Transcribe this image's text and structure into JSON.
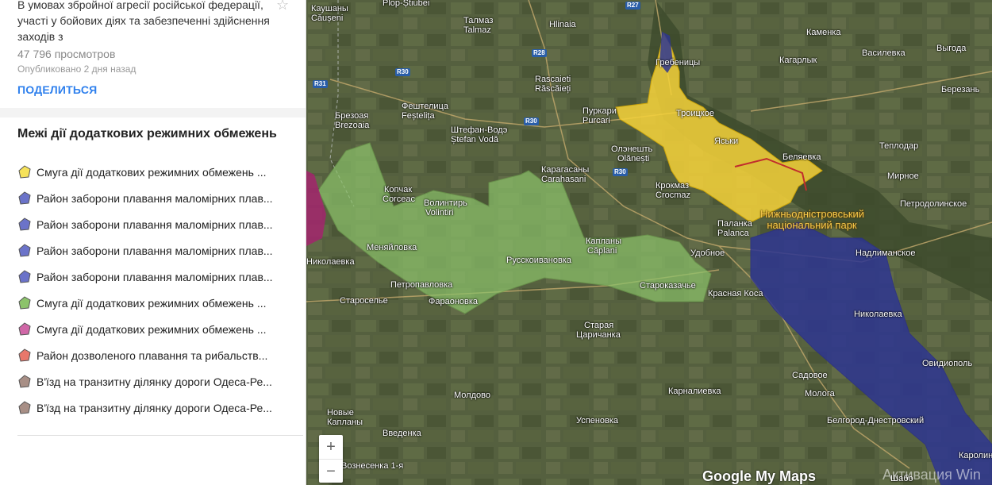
{
  "description": "В умовах збройної агресії російської федерації, участі у бойових діях та забезпеченні здійснення заходів з",
  "views": "47 796 просмотров",
  "published": "Опубликовано 2 дня назад",
  "share_label": "ПОДЕЛИТЬСЯ",
  "layer_title": "Межі дії додаткових режимних обмежень",
  "legend": [
    {
      "label": "Смуга дії додаткових режимних обмежень ...",
      "color": "#f6e25a"
    },
    {
      "label": "Район заборони плавання маломірних плав...",
      "color": "#6b73c9"
    },
    {
      "label": "Район заборони плавання маломірних плав...",
      "color": "#6b73c9"
    },
    {
      "label": "Район заборони плавання маломірних плав...",
      "color": "#6b73c9"
    },
    {
      "label": "Район заборони плавання маломірних плав...",
      "color": "#6b73c9"
    },
    {
      "label": "Смуга дії додаткових режимних обмежень ...",
      "color": "#8cc36b"
    },
    {
      "label": "Смуга дії додаткових режимних обмежень ...",
      "color": "#d067a7"
    },
    {
      "label": "Район дозволеного плавання та рибальств...",
      "color": "#e8776b"
    },
    {
      "label": "В'їзд на транзитну ділянку дороги Одеса-Ре...",
      "color": "#a88f86"
    },
    {
      "label": "В'їзд на транзитну ділянку дороги Одеса-Ре...",
      "color": "#a88f86"
    }
  ],
  "map": {
    "places": [
      "Каушаны",
      "Căușeni",
      "Plop-Știubei",
      "Талмаз",
      "Talmaz",
      "Hlinaia",
      "Каменка",
      "Гребеницы",
      "Кагарлык",
      "Василевка",
      "Выгода",
      "Rascaieti",
      "Răscăieți",
      "Березань",
      "Брезоая",
      "Brezoaia",
      "Фештелица",
      "Feștelița",
      "Пуркари",
      "Purcari",
      "Троицкое",
      "Штефан-Водэ",
      "Ștefan Vodă",
      "Яськи",
      "Теплодар",
      "Олэнешть",
      "Olănești",
      "Беляевка",
      "Карагасаны",
      "Carahasani",
      "Мирное",
      "Копчак",
      "Corceac",
      "Волинтирь",
      "Volintiri",
      "Крокмаз",
      "Crocmaz",
      "Петродолинское",
      "Паланка",
      "Palanca",
      "Капланы",
      "Căplani",
      "Николаевка",
      "Меняйловка",
      "Удобное",
      "Надлиманское",
      "Русскоивановка",
      "Петропавловка",
      "Старосельe",
      "Староказачье",
      "Фараоновка",
      "Красная Коса",
      "Николаевка",
      "Старая",
      "Царичанка",
      "Овидиополь",
      "Садовое",
      "Молдово",
      "Карналиевка",
      "Молога",
      "Новые",
      "Капланы",
      "Успеновка",
      "Белгород-Днестровский",
      "Введенка",
      "Вознесенка 1-я",
      "Шабо",
      "Каролино"
    ],
    "roads": [
      "R27",
      "R28",
      "R30",
      "R31",
      "R30",
      "R30"
    ],
    "park_label": "Нижньодністровський національний парк",
    "attribution": "Google My Maps",
    "watermark": "Активация Win"
  },
  "zoom_in": "+",
  "zoom_out": "−"
}
